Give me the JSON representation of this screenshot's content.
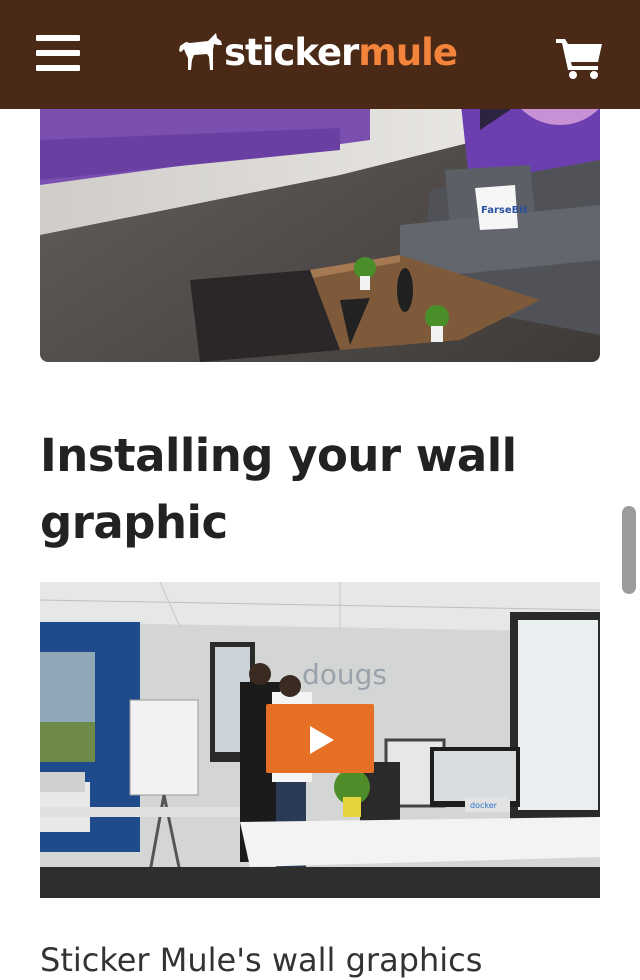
{
  "header": {
    "brand_part1": "sticker",
    "brand_part2": "mule",
    "icons": [
      "menu-icon",
      "mule-logo-icon",
      "cart-icon"
    ],
    "colors": {
      "bar": "#4a2a16",
      "accent": "#f4833b"
    }
  },
  "section": {
    "heading": "Installing your wall graphic",
    "video_wall_text": "dougs",
    "video_sign_text": "docker",
    "photo_pillow_text": "FarseBit"
  },
  "body": {
    "partial_text": "Sticker Mule's wall graphics"
  },
  "colors": {
    "play_button": "#e56f24"
  }
}
